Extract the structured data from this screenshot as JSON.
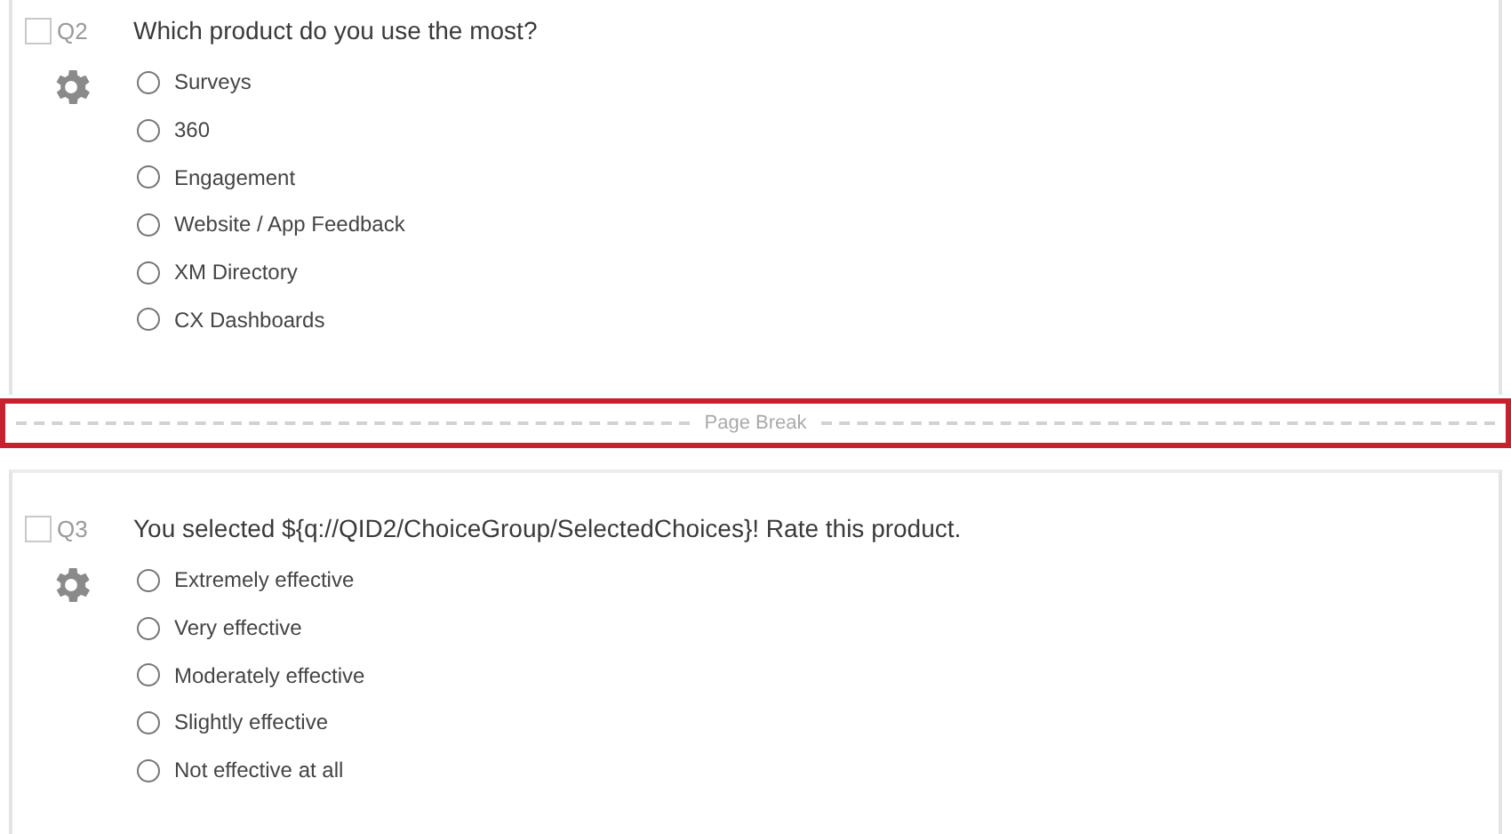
{
  "blocks": [
    {
      "kind": "question",
      "number": "Q2",
      "checked": false,
      "text": "Which product do you use the most?",
      "choices": [
        {
          "label": "Surveys",
          "selected": false
        },
        {
          "label": "360",
          "selected": false
        },
        {
          "label": "Engagement",
          "selected": false
        },
        {
          "label": "Website / App Feedback",
          "selected": false
        },
        {
          "label": "XM Directory",
          "selected": false
        },
        {
          "label": "CX Dashboards",
          "selected": false
        }
      ]
    },
    {
      "kind": "page_break",
      "label": "Page Break",
      "highlighted": true
    },
    {
      "kind": "question",
      "number": "Q3",
      "checked": false,
      "text": "You selected ${q://QID2/ChoiceGroup/SelectedChoices}! Rate this product.",
      "choices": [
        {
          "label": "Extremely effective",
          "selected": false
        },
        {
          "label": "Very effective",
          "selected": false
        },
        {
          "label": "Moderately effective",
          "selected": false
        },
        {
          "label": "Slightly effective",
          "selected": false
        },
        {
          "label": "Not effective at all",
          "selected": false
        }
      ]
    }
  ]
}
